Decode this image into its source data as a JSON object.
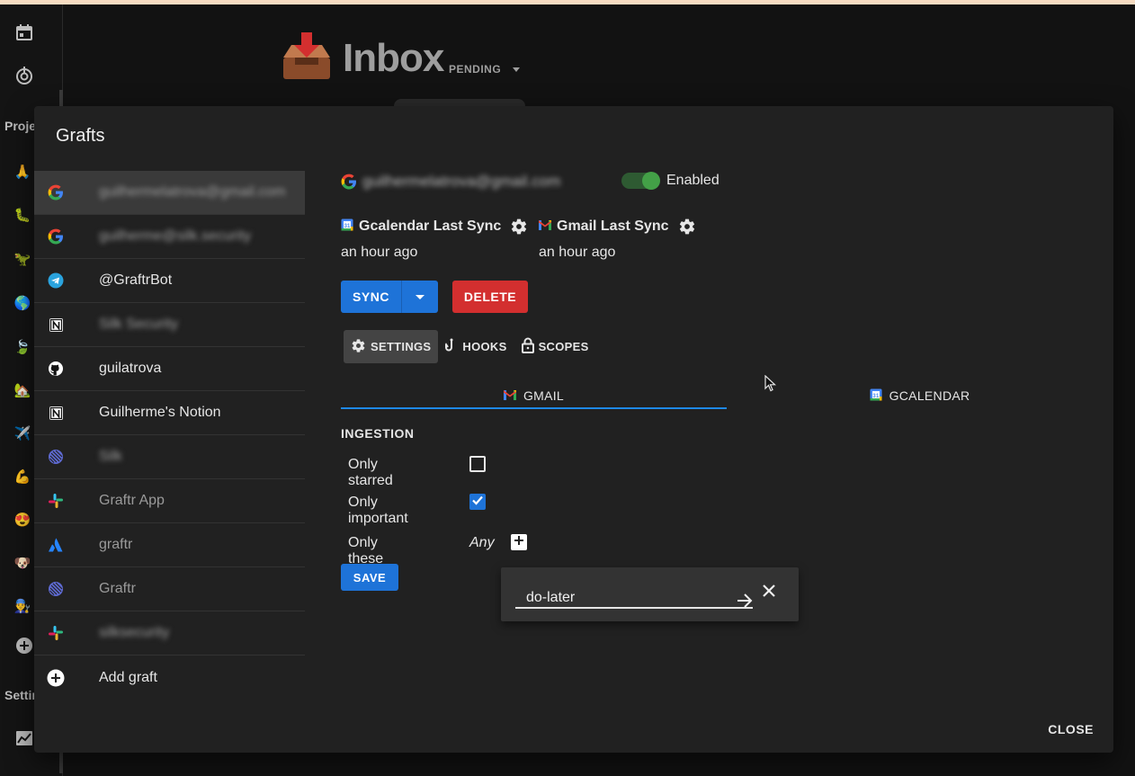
{
  "header": {
    "title": "Inbox",
    "filter": "PENDING"
  },
  "rail": {
    "projects_label": "Proje",
    "settings_label": "Settin"
  },
  "dialog": {
    "title": "Grafts",
    "close_label": "CLOSE",
    "grafts": [
      {
        "label": "guilhermelatrova@gmail.com",
        "icon": "google-icon",
        "blurred": true,
        "selected": true
      },
      {
        "label": "guilherme@silk.security",
        "icon": "google-icon",
        "blurred": true
      },
      {
        "label": "@GraftrBot",
        "icon": "telegram-icon"
      },
      {
        "label": "Silk Security",
        "icon": "notion-icon",
        "blurred": true
      },
      {
        "label": "guilatrova",
        "icon": "github-icon"
      },
      {
        "label": "Guilherme's Notion",
        "icon": "notion-icon"
      },
      {
        "label": "Silk",
        "icon": "linear-icon",
        "blurred": true
      },
      {
        "label": "Graftr App",
        "icon": "slack-icon"
      },
      {
        "label": "graftr",
        "icon": "atlassian-icon"
      },
      {
        "label": "Graftr",
        "icon": "linear-icon"
      },
      {
        "label": "silksecurity",
        "icon": "slack-icon",
        "blurred": true
      }
    ],
    "add_graft_label": "Add graft",
    "account": {
      "email": "guilhermelatrova@gmail.com",
      "enabled_label": "Enabled",
      "enabled": true
    },
    "syncs": [
      {
        "label": "Gcalendar Last Sync",
        "time": "an hour ago",
        "icon": "gcalendar-icon"
      },
      {
        "label": "Gmail Last Sync",
        "time": "an hour ago",
        "icon": "gmail-icon"
      }
    ],
    "sync_label": "SYNC",
    "delete_label": "DELETE",
    "subtabs": [
      {
        "label": "SETTINGS",
        "icon": "gear-icon",
        "active": true
      },
      {
        "label": "HOOKS",
        "icon": "hook-icon"
      },
      {
        "label": "SCOPES",
        "icon": "lock-icon"
      }
    ],
    "tabs": [
      {
        "label": "GMAIL",
        "icon": "gmail-icon",
        "active": true
      },
      {
        "label": "GCALENDAR",
        "icon": "gcalendar-icon"
      }
    ],
    "settings": {
      "section": "INGESTION",
      "only_starred_label": "Only starred",
      "only_starred": false,
      "only_important_label": "Only important",
      "only_important": true,
      "only_labels_label": "Only these labels",
      "only_labels_value": "Any",
      "save_label": "SAVE"
    },
    "label_popover": {
      "input_value": "do-later"
    }
  },
  "colors": {
    "primary": "#1e73d8",
    "danger": "#d32f2f",
    "switch_on": "#43a047",
    "top_strip": "#f7dcc2"
  }
}
